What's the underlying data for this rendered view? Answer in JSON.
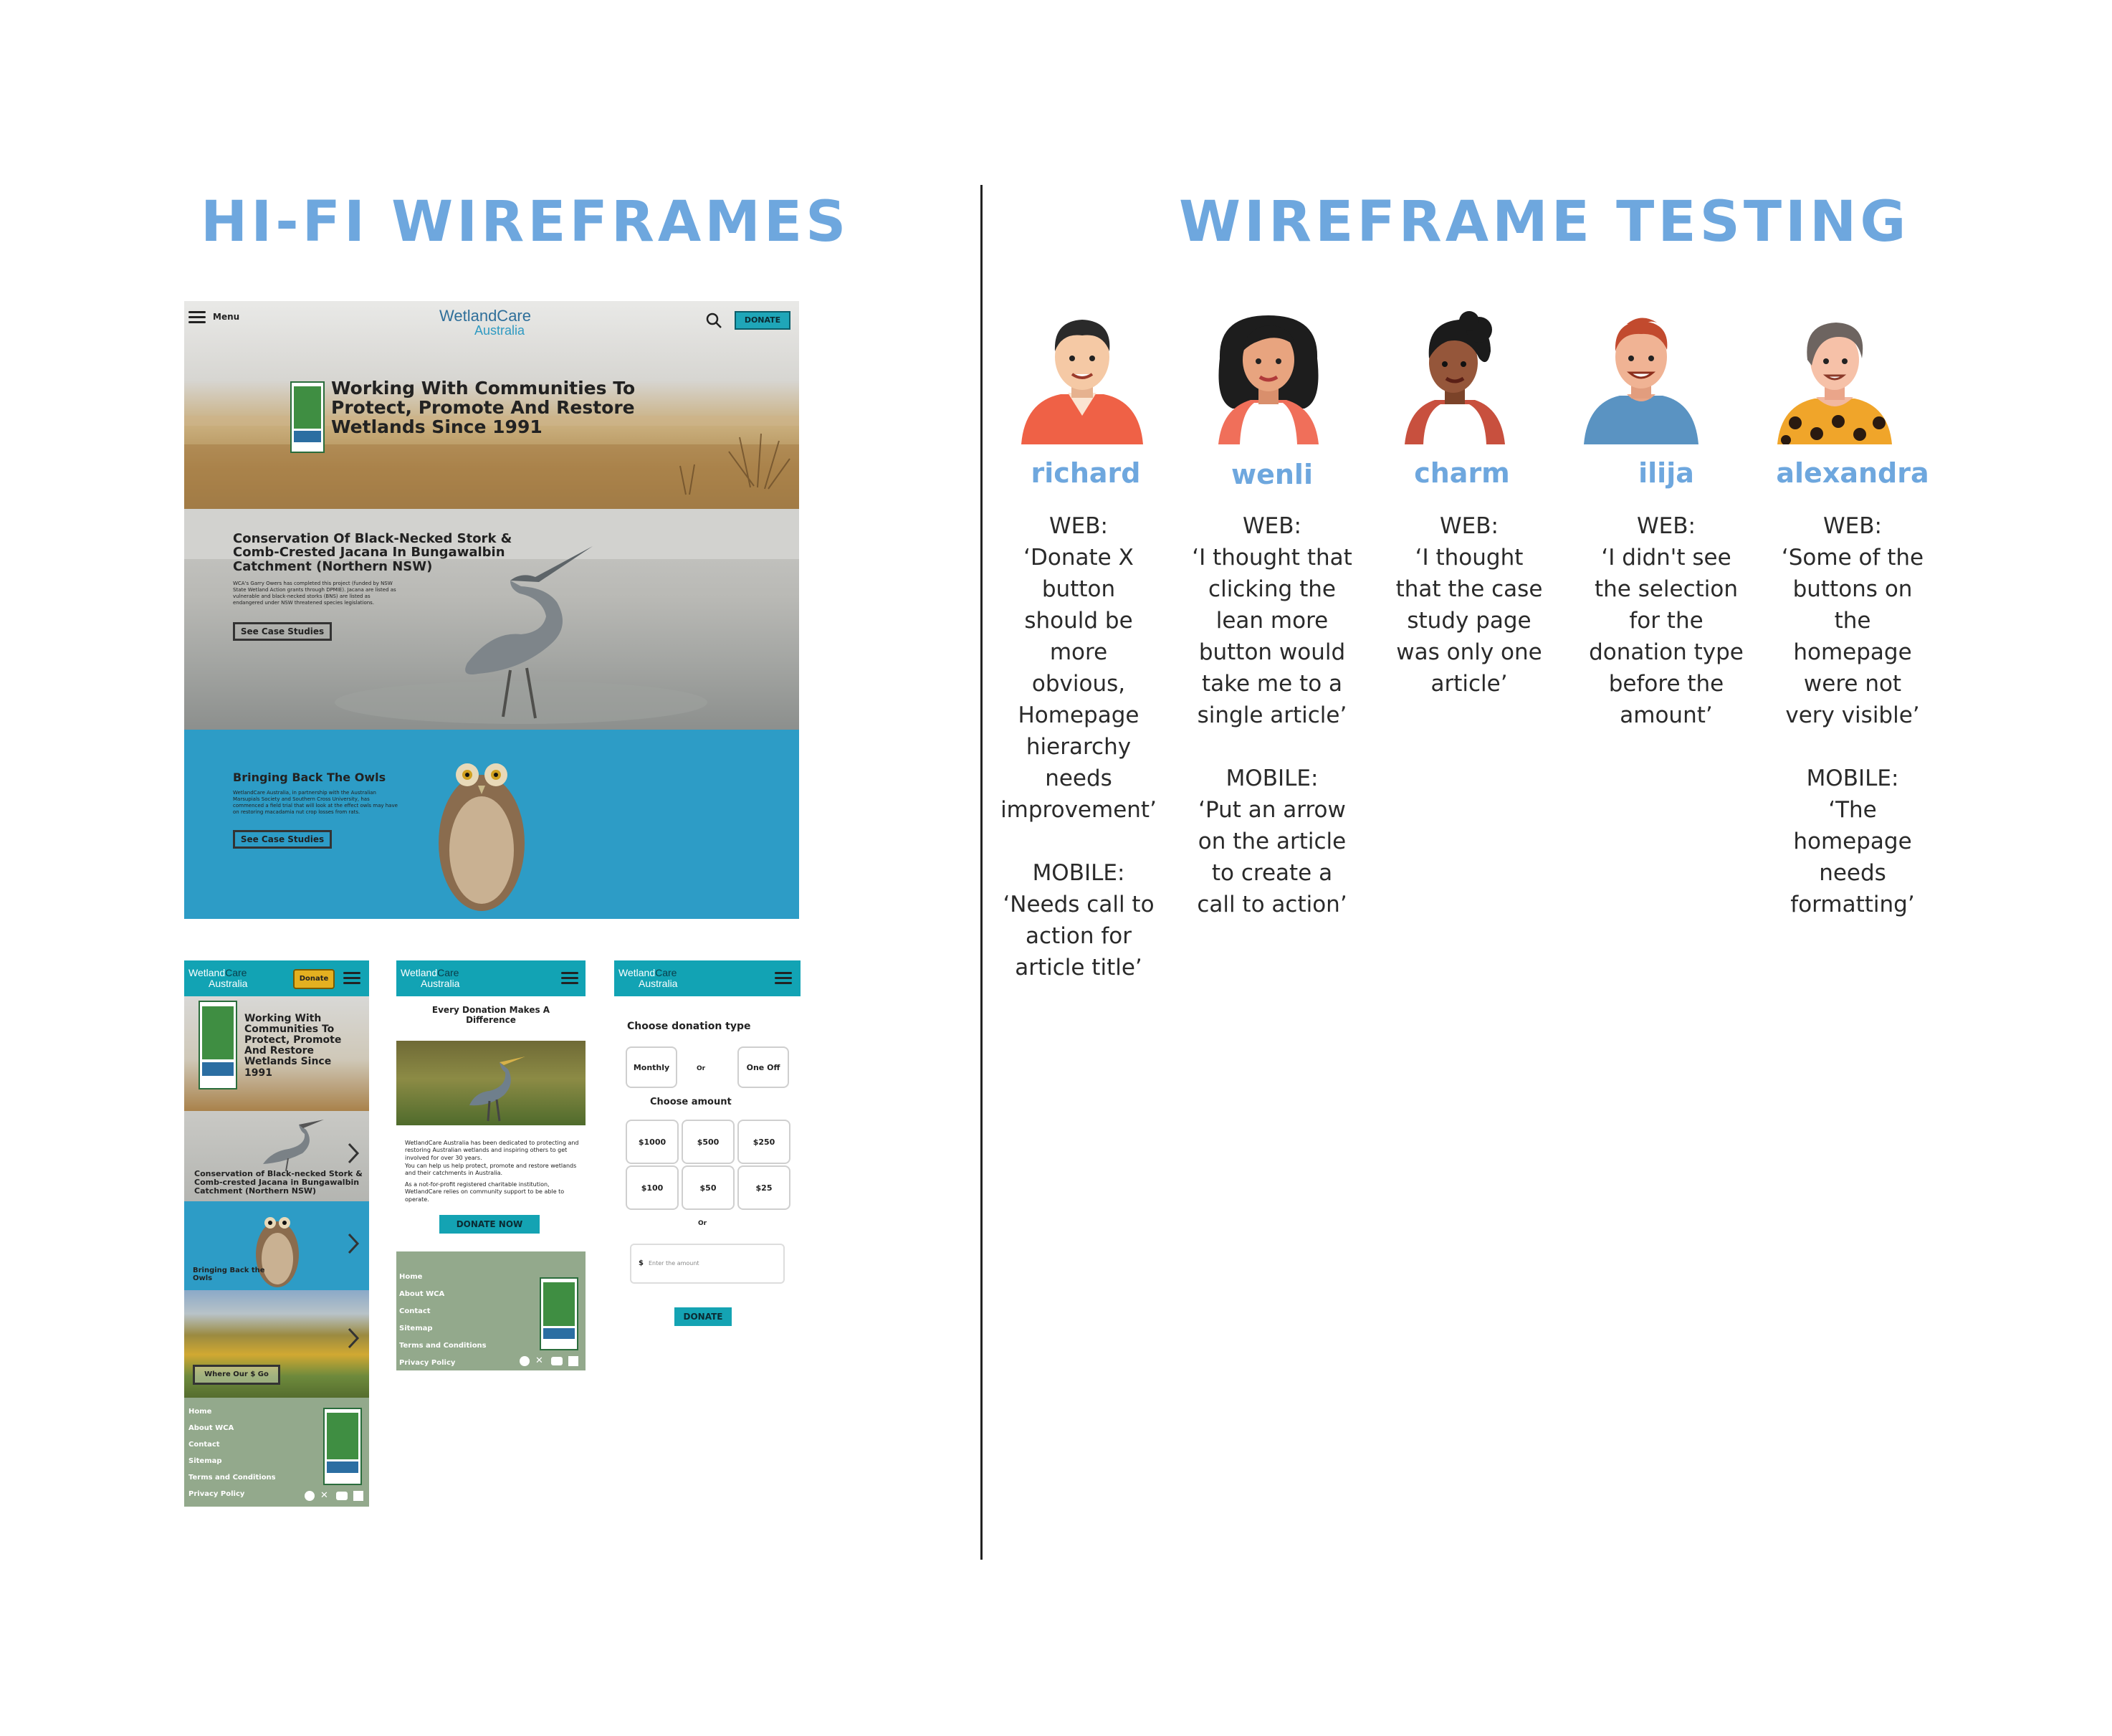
{
  "left_title": "HI-FI WIREFRAMES",
  "right_title": "WIREFRAME TESTING",
  "desktop": {
    "menu_label": "Menu",
    "logo_line1": "WetlandCare",
    "logo_line2": "Australia",
    "donate_label": "DONATE",
    "hero_title": "Working With Communities To Protect, Promote And Restore Wetlands Since 1991",
    "stork_title": "Conservation Of Black-Necked Stork & Comb-Crested Jacana In Bungawalbin Catchment (Northern NSW)",
    "stork_body": "WCA's Garry Owers has completed this project (funded by NSW State Wetland Action grants through DPMIE). Jacana are listed as vulnerable and black-necked storks (BNS) are listed as endangered under NSW threatened species legislations.",
    "stork_button": "See Case Studies",
    "owl_title": "Bringing Back The Owls",
    "owl_body": "WetlandCare Australia, in partnership with the Australian Marsupials Society and Southern Cross University, has commenced a field trial that will look at the effect owls may have on restoring macadamia nut crop losses from rats.",
    "owl_button": "See Case Studies"
  },
  "mobile_home": {
    "logo_line1": "Wetland",
    "logo_line1b": "Care",
    "logo_line2": "Australia",
    "donate_label": "Donate",
    "hero_title": "Working With Communities To Protect, Promote And Restore Wetlands Since 1991",
    "stork_title": "Conservation of Black-necked Stork & Comb-crested Jacana in Bungawalbin Catchment (Northern NSW)",
    "owl_title": "Bringing Back the Owls",
    "where_button": "Where Our $ Go",
    "footer_links": [
      "Home",
      "About WCA",
      "Contact",
      "Sitemap",
      "Terms and Conditions",
      "Privacy Policy"
    ]
  },
  "mobile_donate_info": {
    "logo_line1": "Wetland",
    "logo_line1b": "Care",
    "logo_line2": "Australia",
    "heading": "Every Donation Makes A Difference",
    "para1": "WetlandCare Australia has been dedicated to protecting and restoring Australian wetlands and inspiring others to get involved for over 30 years.",
    "para2": "You can help us help protect, promote and restore wetlands and their catchments in Australia.",
    "para3": "As a not-for-profit registered charitable institution, WetlandCare relies on community support to be able to operate.",
    "donate_button": "DONATE NOW",
    "footer_links": [
      "Home",
      "About WCA",
      "Contact",
      "Sitemap",
      "Terms and Conditions",
      "Privacy Policy"
    ]
  },
  "mobile_donate_form": {
    "logo_line1": "Wetland",
    "logo_line1b": "Care",
    "logo_line2": "Australia",
    "type_heading": "Choose donation type",
    "monthly": "Monthly",
    "or": "Or",
    "one_off": "One Off",
    "amount_heading": "Choose amount",
    "amounts": [
      "$1000",
      "$500",
      "$250",
      "$100",
      "$50",
      "$25"
    ],
    "or2": "Or",
    "currency": "$",
    "amount_placeholder": "Enter the amount",
    "donate_button": "DONATE"
  },
  "personas": [
    {
      "name": "richard",
      "quote": "WEB:\n‘Donate X\nbutton\nshould be\nmore\nobvious,\nHomepage\nhierarchy\nneeds\nimprovement’\n\nMOBILE:\n‘Needs call to\naction for\narticle title’"
    },
    {
      "name": "wenli",
      "quote": "WEB:\n‘I thought that\nclicking the\nlean more\nbutton would\ntake me to a\nsingle article’\n\nMOBILE:\n‘Put an arrow\non the article\nto create a\ncall to action’"
    },
    {
      "name": "charm",
      "quote": "WEB:\n‘I thought\nthat the case\nstudy page\nwas only one\narticle’"
    },
    {
      "name": "ilija",
      "quote": "WEB:\n‘I didn't see\nthe selection\nfor the\ndonation type\nbefore the\namount’"
    },
    {
      "name": "alexandra",
      "quote": "WEB:\n‘Some of the\nbuttons on\nthe\nhomepage\nwere not\nvery visible’\n\nMOBILE:\n‘The\nhomepage\nneeds\nformatting’"
    }
  ]
}
